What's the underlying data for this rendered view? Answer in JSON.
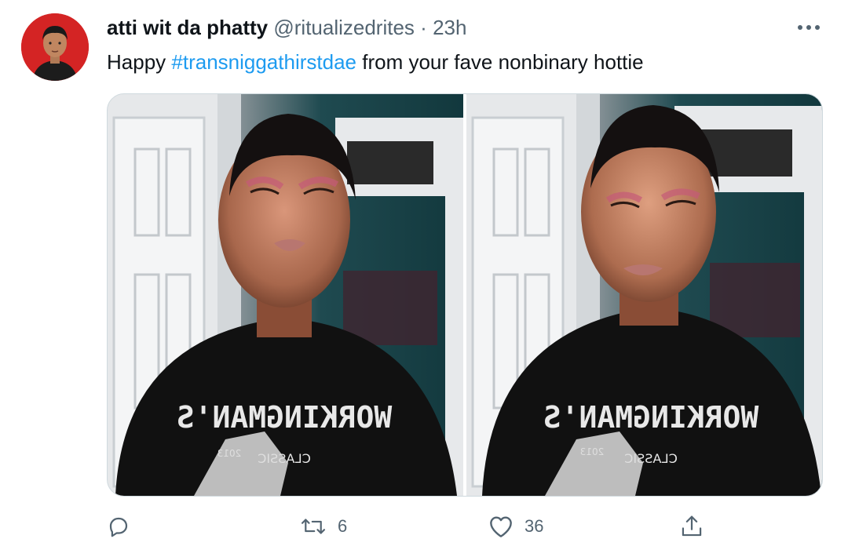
{
  "tweet": {
    "display_name": "atti wit da phatty",
    "handle": "@ritualizedrites",
    "separator": "·",
    "time": "23h",
    "text_before": "Happy ",
    "hashtag": "#transniggathirstdae",
    "text_after": " from your fave nonbinary hottie",
    "shirt_text": "WORKINGMAN'S",
    "shirt_subtext": "CLASSIC",
    "shirt_year": "2013"
  },
  "actions": {
    "reply_count": "",
    "retweet_count": "6",
    "like_count": "36"
  },
  "icons": {
    "more": "more-horizontal-icon",
    "reply": "reply-icon",
    "retweet": "retweet-icon",
    "like": "heart-icon",
    "share": "share-icon"
  },
  "colors": {
    "link": "#1d9bf0",
    "secondary_text": "#536471",
    "avatar_bg": "#d42424"
  }
}
